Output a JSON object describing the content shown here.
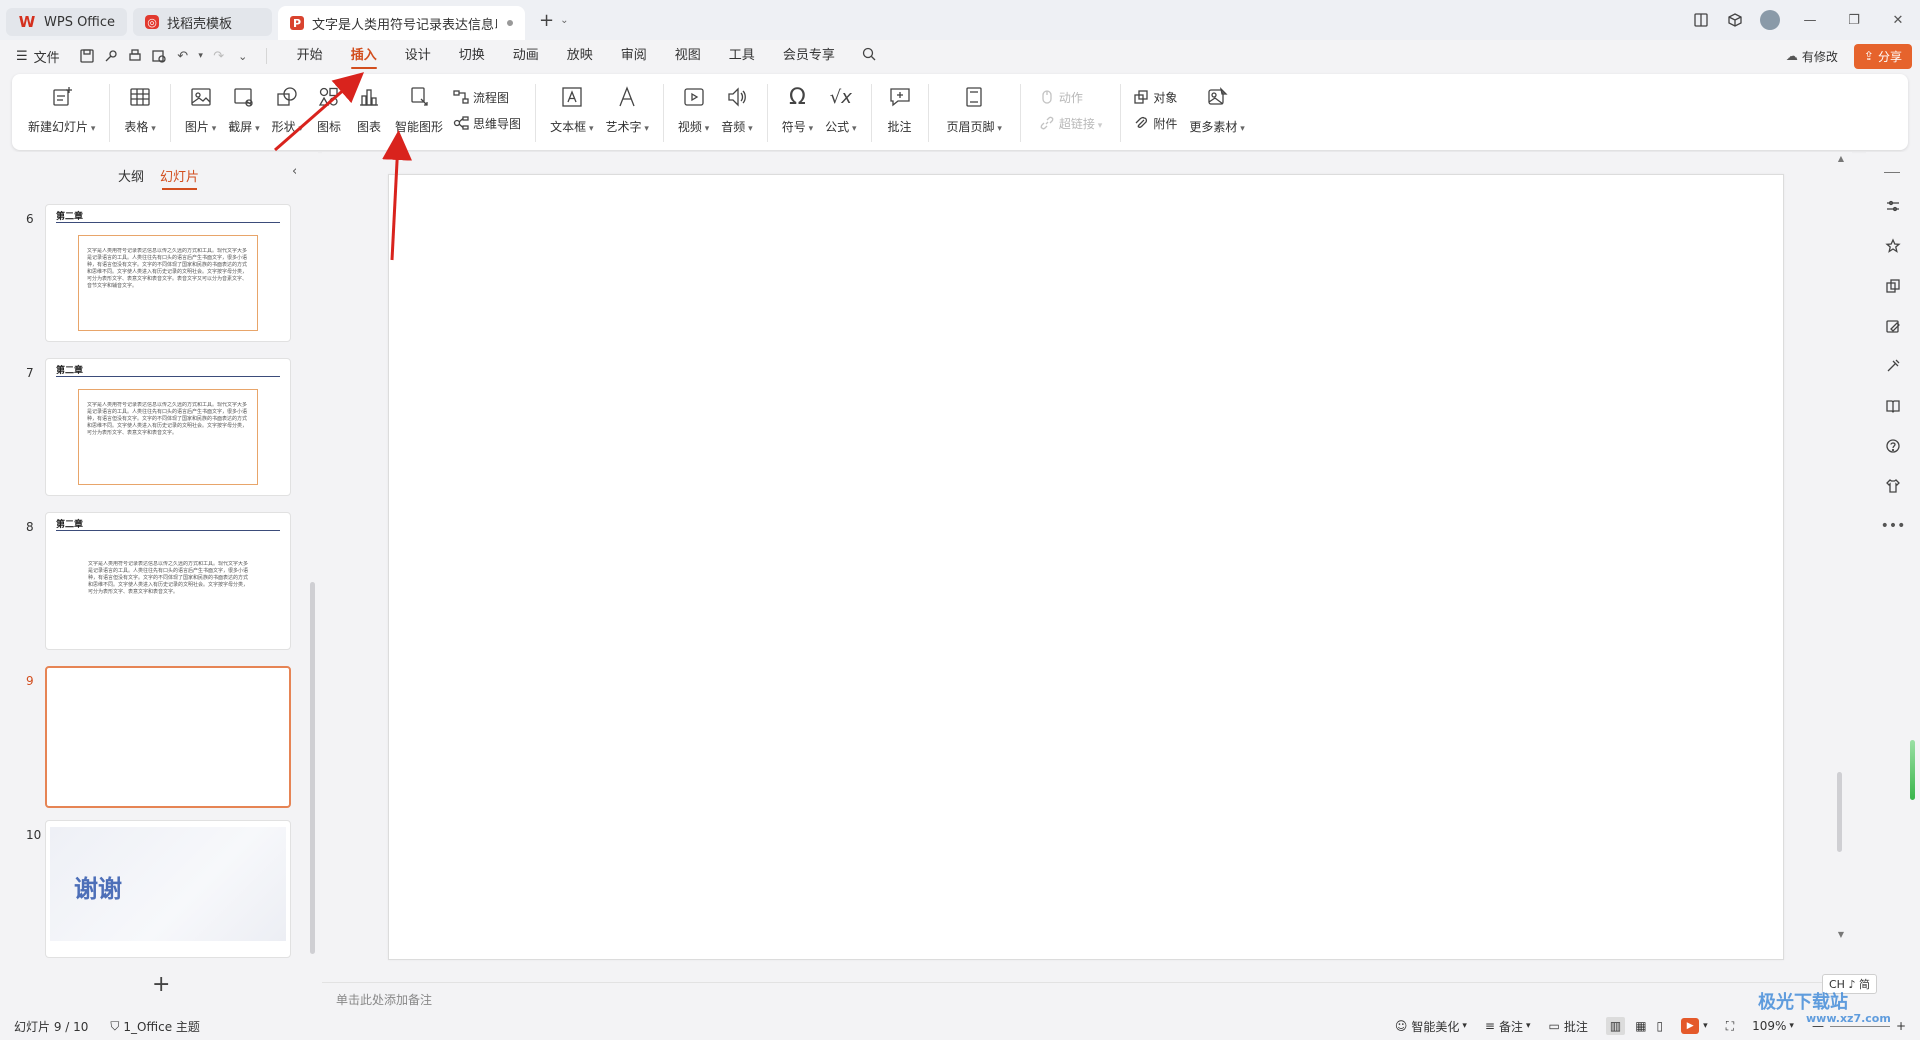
{
  "titlebar": {
    "tabs": [
      {
        "label": "WPS Office",
        "icon": "wps-logo-icon"
      },
      {
        "label": "找稻壳模板",
        "icon": "template-icon"
      },
      {
        "label": "文字是人类用符号记录表达信息以",
        "icon": "ppt-file-icon"
      }
    ]
  },
  "menu": {
    "file_label": "文件",
    "tabs": [
      "开始",
      "插入",
      "设计",
      "切换",
      "动画",
      "放映",
      "审阅",
      "视图",
      "工具",
      "会员专享"
    ],
    "active_tab": "插入",
    "modified_label": "有修改",
    "share_label": "分享"
  },
  "ribbon": {
    "new_slide": "新建幻灯片",
    "table": "表格",
    "picture": "图片",
    "screenshot": "截屏",
    "shape": "形状",
    "icon": "图标",
    "chart": "图表",
    "smartart": "智能图形",
    "flowchart": "流程图",
    "mindmap": "思维导图",
    "textbox": "文本框",
    "wordart": "艺术字",
    "video": "视频",
    "audio": "音频",
    "symbol": "符号",
    "formula": "公式",
    "comment": "批注",
    "header_footer": "页眉页脚",
    "action": "动作",
    "hyperlink": "超链接",
    "object": "对象",
    "attachment": "附件",
    "more_assets": "更多素材"
  },
  "left_panel": {
    "tab_outline": "大纲",
    "tab_slides": "幻灯片",
    "slides": [
      {
        "num": "6",
        "title": "第二章",
        "body": "文字是人类用符号记录表达信息以传之久远的方式和工具。现代文字大多是记录语言的工具。人类往往先有口头的语言后产生书面文字，很多小语种，有语言但没有文字。文字的不同体现了国家和民族的书面表达的方式和思维不同。文字使人类进入有历史记录的文明社会。文字按字母分类，可分为表形文字、表意文字和表音文字。表音文字又可以分为音素文字、音节文字和辅音文字。"
      },
      {
        "num": "7",
        "title": "第二章",
        "body": "文字是人类用符号记录表达信息以传之久远的方式和工具。现代文字大多是记录语言的工具。人类往往先有口头的语言后产生书面文字，很多小语种，有语言但没有文字。文字的不同体现了国家和民族的书面表达的方式和思维不同。文字使人类进入有历史记录的文明社会。文字按字母分类，可分为表形文字、表意文字和表音文字。"
      },
      {
        "num": "8",
        "title": "第二章",
        "body": "文字是人类用符号记录表达信息以传之久远的方式和工具。现代文字大多是记录语言的工具。人类往往先有口头的语言后产生书面文字，很多小语种，有语言但没有文字。文字的不同体现了国家和民族的书面表达的方式和思维不同。文字使人类进入有历史记录的文明社会。文字按字母分类，可分为表形文字、表意文字和表音文字。"
      },
      {
        "num": "9"
      },
      {
        "num": "10",
        "title": "谢谢"
      }
    ]
  },
  "notes_placeholder": "单击此处添加备注",
  "status": {
    "slide_counter": "幻灯片 9 / 10",
    "theme": "1_Office 主题",
    "beautify": "智能美化",
    "notes": "备注",
    "comment": "批注",
    "zoom": "109%"
  },
  "ime": "CH ♪ 简",
  "watermark": {
    "main": "极光下载站",
    "sub": "www.xz7.com"
  },
  "colors": {
    "accent": "#d24e1e",
    "share": "#e6632c",
    "arrow": "#d9231d"
  }
}
